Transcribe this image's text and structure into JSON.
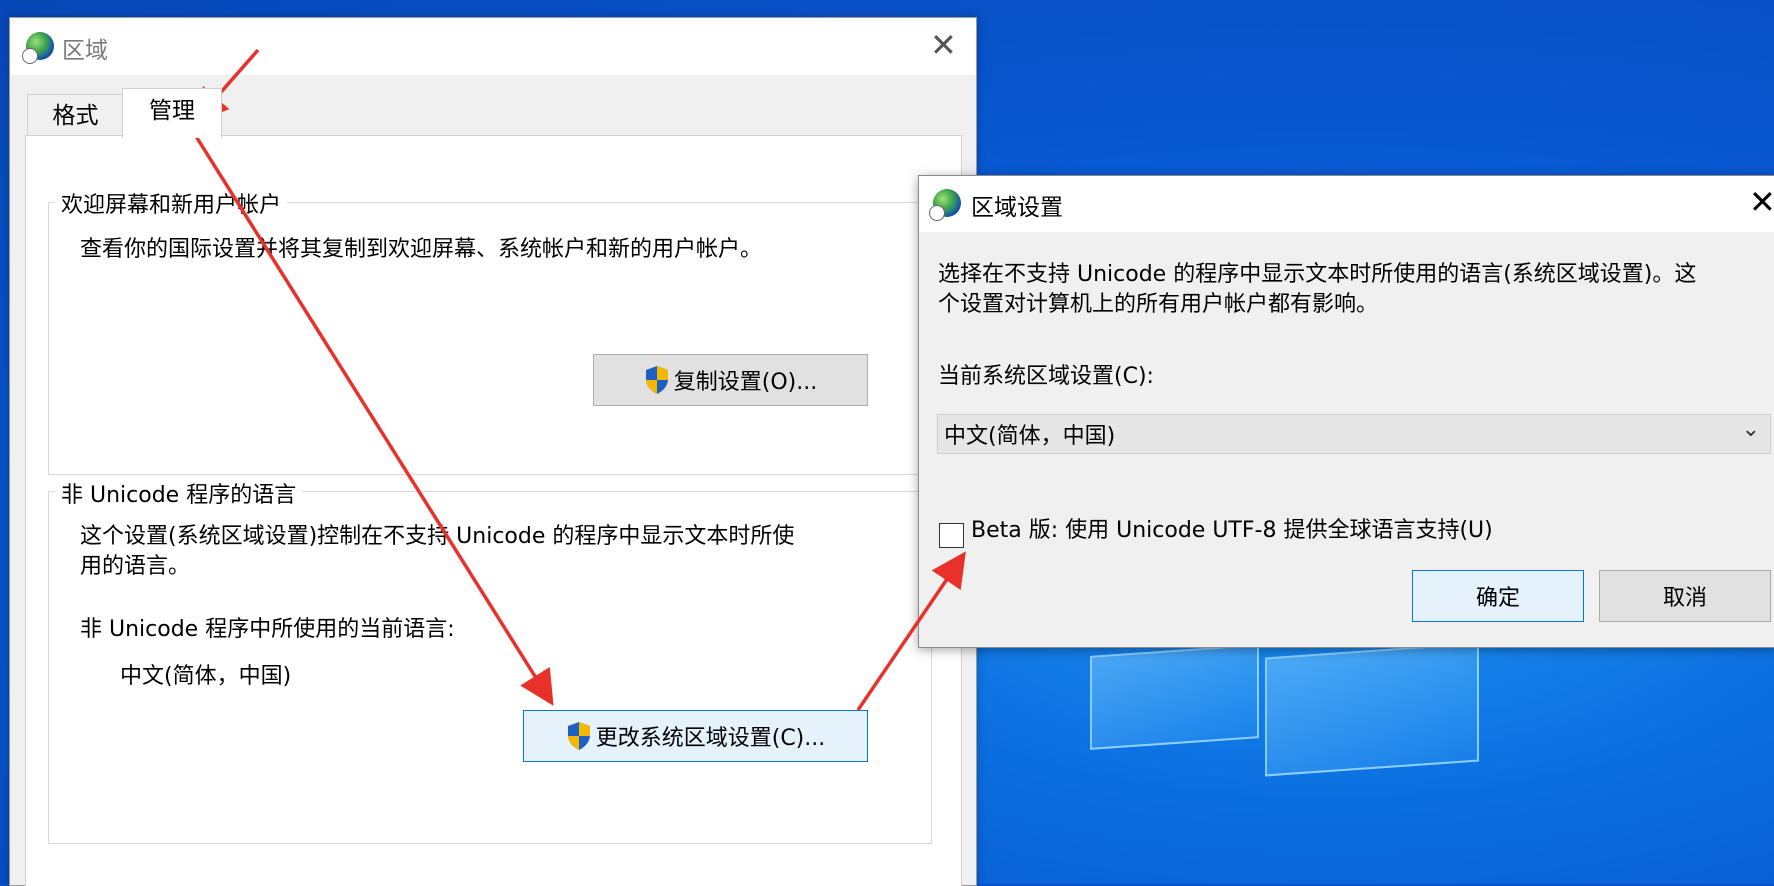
{
  "main_dialog": {
    "title": "区域",
    "tabs": [
      {
        "label": "格式"
      },
      {
        "label": "管理"
      }
    ],
    "welcome_group": {
      "title": "欢迎屏幕和新用户帐户",
      "description": "查看你的国际设置并将其复制到欢迎屏幕、系统帐户和新的用户帐户。",
      "copy_button": "复制设置(O)..."
    },
    "non_unicode_group": {
      "title": "非 Unicode 程序的语言",
      "description_line1": "这个设置(系统区域设置)控制在不支持 Unicode 的程序中显示文本时所使",
      "description_line2": "用的语言。",
      "current_label": "非 Unicode 程序中所使用的当前语言:",
      "current_value": "中文(简体，中国)",
      "change_button": "更改系统区域设置(C)..."
    }
  },
  "region_dialog": {
    "title": "区域设置",
    "description_line1": "选择在不支持 Unicode 的程序中显示文本时所使用的语言(系统区域设置)。这",
    "description_line2": "个设置对计算机上的所有用户帐户都有影响。",
    "current_label": "当前系统区域设置(C):",
    "selected_locale": "中文(简体，中国)",
    "beta_checkbox_label": "Beta 版: 使用 Unicode UTF-8 提供全球语言支持(U)",
    "beta_checked": false,
    "ok_button": "确定",
    "cancel_button": "取消"
  },
  "icons": {
    "window_icon": "globe-clock-icon",
    "uac": "uac-shield-icon",
    "close": "close-icon",
    "dropdown": "chevron-down-icon"
  },
  "colors": {
    "annotation_arrow": "#e8312a",
    "accent": "#0078d7",
    "desktop": "#0857d0"
  }
}
